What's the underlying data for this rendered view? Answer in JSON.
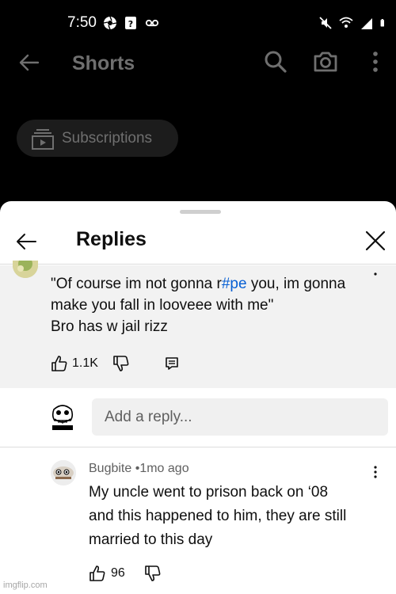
{
  "status_bar": {
    "time": "7:50",
    "left_icons": [
      "aperture-icon",
      "unknown-app-icon",
      "voicemail-icon"
    ],
    "right_icons": [
      "mute-icon",
      "wifi-icon",
      "signal-icon",
      "battery-icon"
    ]
  },
  "topbar": {
    "title": "Shorts",
    "icons": [
      "back-arrow-icon",
      "search-icon",
      "camera-icon",
      "more-vert-icon"
    ]
  },
  "subscriptions_chip": {
    "label": "Subscriptions",
    "icon": "subscriptions-icon"
  },
  "sheet": {
    "title": "Replies",
    "icons": [
      "back-arrow-icon",
      "close-icon"
    ]
  },
  "parent_comment": {
    "line1_before": "\"Of course im not gonna r",
    "line1_hashtag": "#pe",
    "line1_after": " you, im gonna",
    "line2": "make you fall in looveee with me\"",
    "line3": "Bro has w jail rizz",
    "like_count": "1.1K"
  },
  "reply_input": {
    "placeholder": "Add a reply..."
  },
  "reply_comment": {
    "author": "Bugbite",
    "separator": "•",
    "time": "1mo ago",
    "line1": "My uncle went to prison back on ‘08",
    "line2": "and this happened to him, they are still",
    "line3": "married to this day",
    "like_count": "96"
  },
  "watermark": "imgflip.com",
  "colors": {
    "background_dark": "#000000",
    "sheet_background": "#ffffff",
    "highlight_background": "#f2f2f2",
    "hashtag_link": "#065fd4",
    "muted_text": "#6f6f6f",
    "chip_background": "#1c1c1c"
  }
}
